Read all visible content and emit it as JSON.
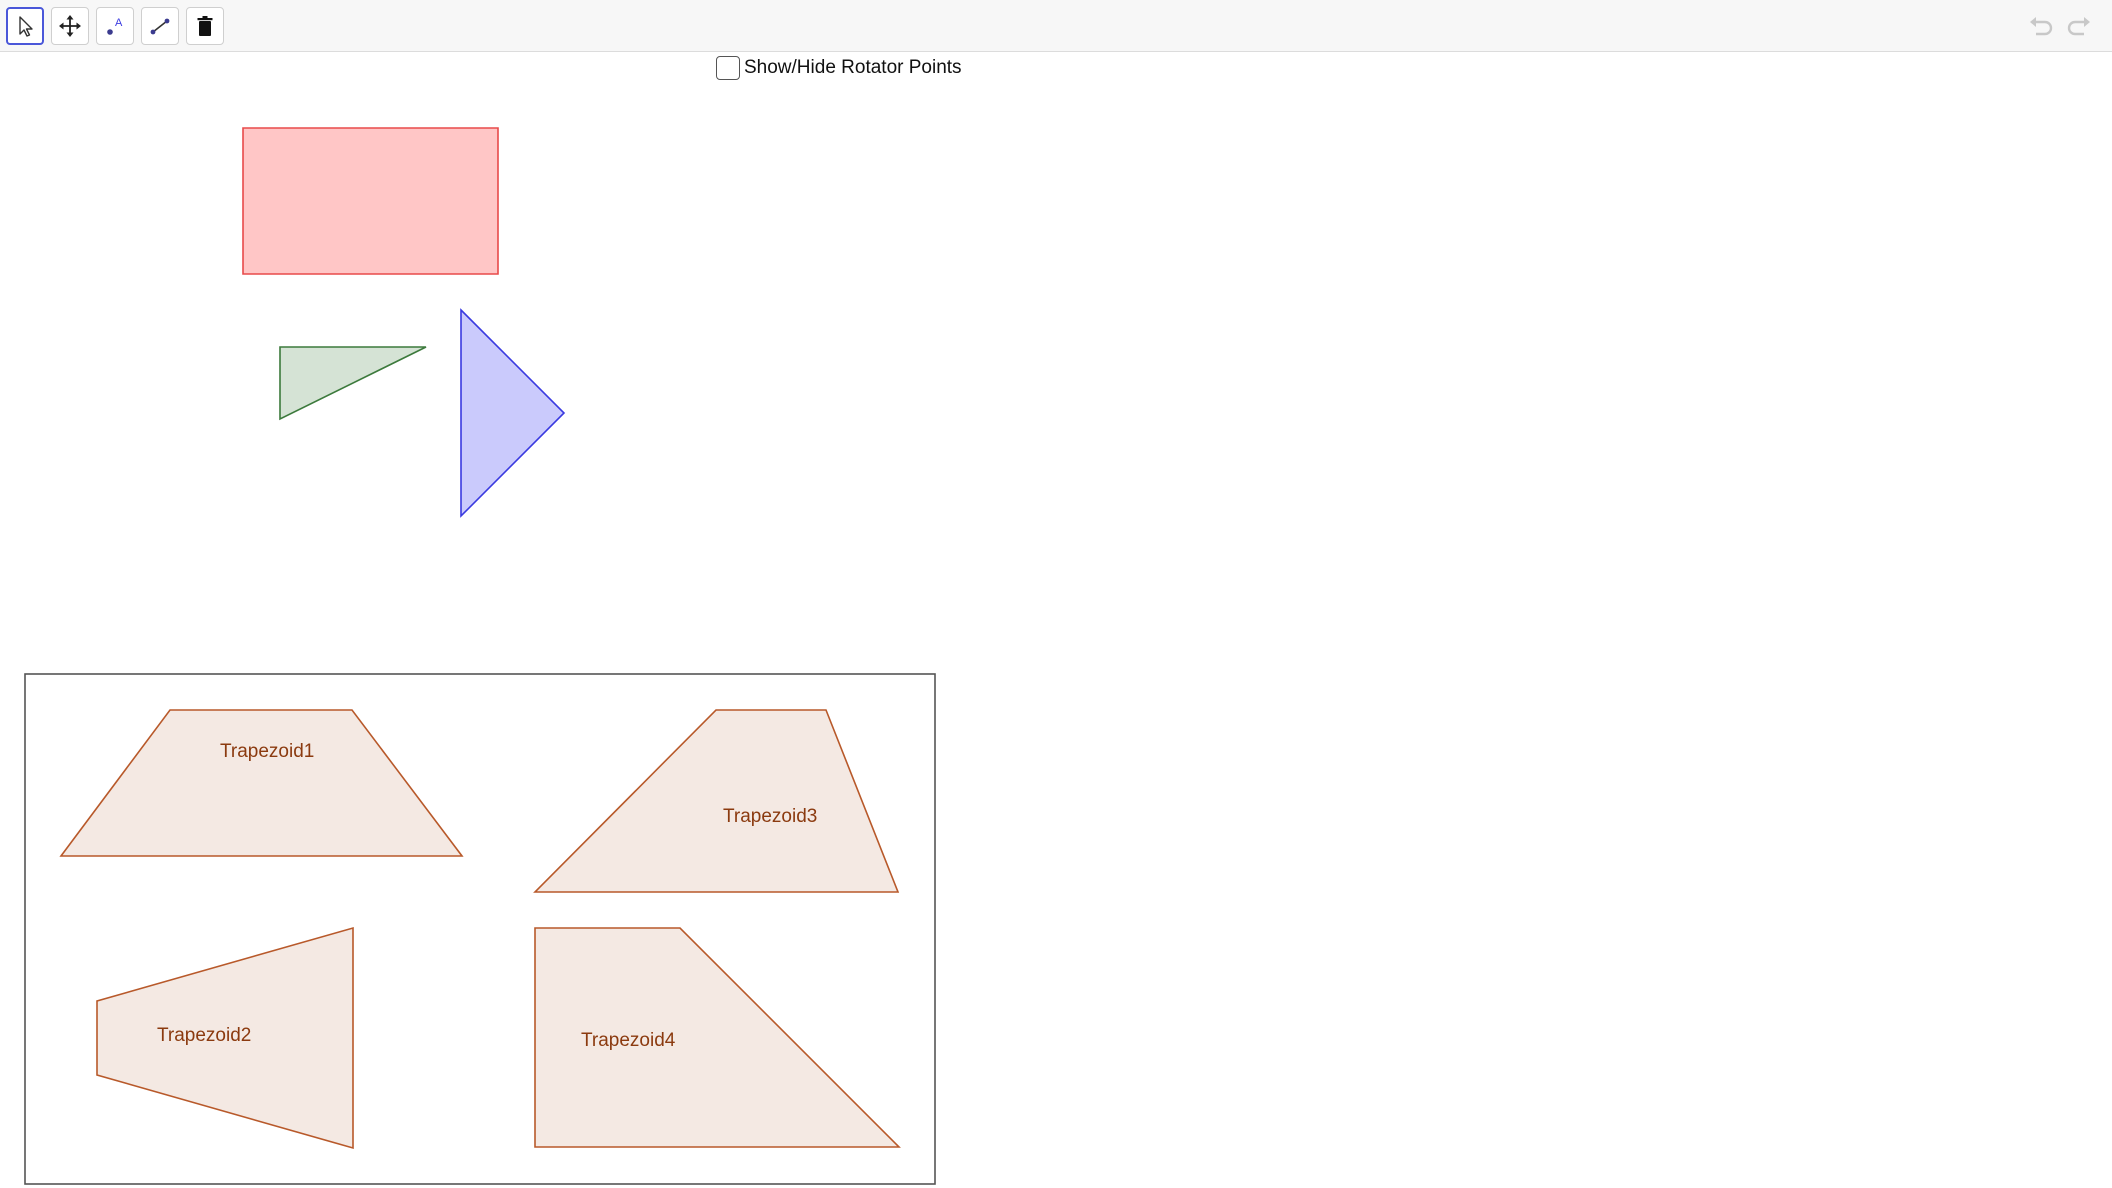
{
  "toolbar": {
    "tools": [
      {
        "id": "select",
        "icon": "arrow-pointer-icon",
        "selected": true
      },
      {
        "id": "move",
        "icon": "move-arrows-icon",
        "selected": false
      },
      {
        "id": "point",
        "icon": "point-label-icon",
        "selected": false
      },
      {
        "id": "segment",
        "icon": "segment-icon",
        "selected": false
      },
      {
        "id": "delete",
        "icon": "trash-icon",
        "selected": false
      }
    ],
    "undo_icon": "undo-icon",
    "redo_icon": "redo-icon"
  },
  "rotator_checkbox": {
    "label": "Show/Hide Rotator Points",
    "checked": false
  },
  "pieces": [
    {
      "name": "rectangle",
      "fill": "#ffc6c6",
      "stroke": "#e84a4a"
    },
    {
      "name": "green-triangle",
      "fill": "#d5e3d5",
      "stroke": "#3c7a3c"
    },
    {
      "name": "blue-triangle",
      "fill": "#cacafc",
      "stroke": "#3a3ae0"
    }
  ],
  "trapezoids": [
    {
      "label": "Trapezoid1",
      "fill": "#f4e9e3",
      "stroke": "#b8592a"
    },
    {
      "label": "Trapezoid2",
      "fill": "#f4e9e3",
      "stroke": "#b8592a"
    },
    {
      "label": "Trapezoid3",
      "fill": "#f4e9e3",
      "stroke": "#b8592a"
    },
    {
      "label": "Trapezoid4",
      "fill": "#f4e9e3",
      "stroke": "#b8592a"
    }
  ],
  "colors": {
    "frame": "#555555",
    "selected_tool_border": "#4a57d9",
    "disabled_icon": "#c8c8c8"
  }
}
